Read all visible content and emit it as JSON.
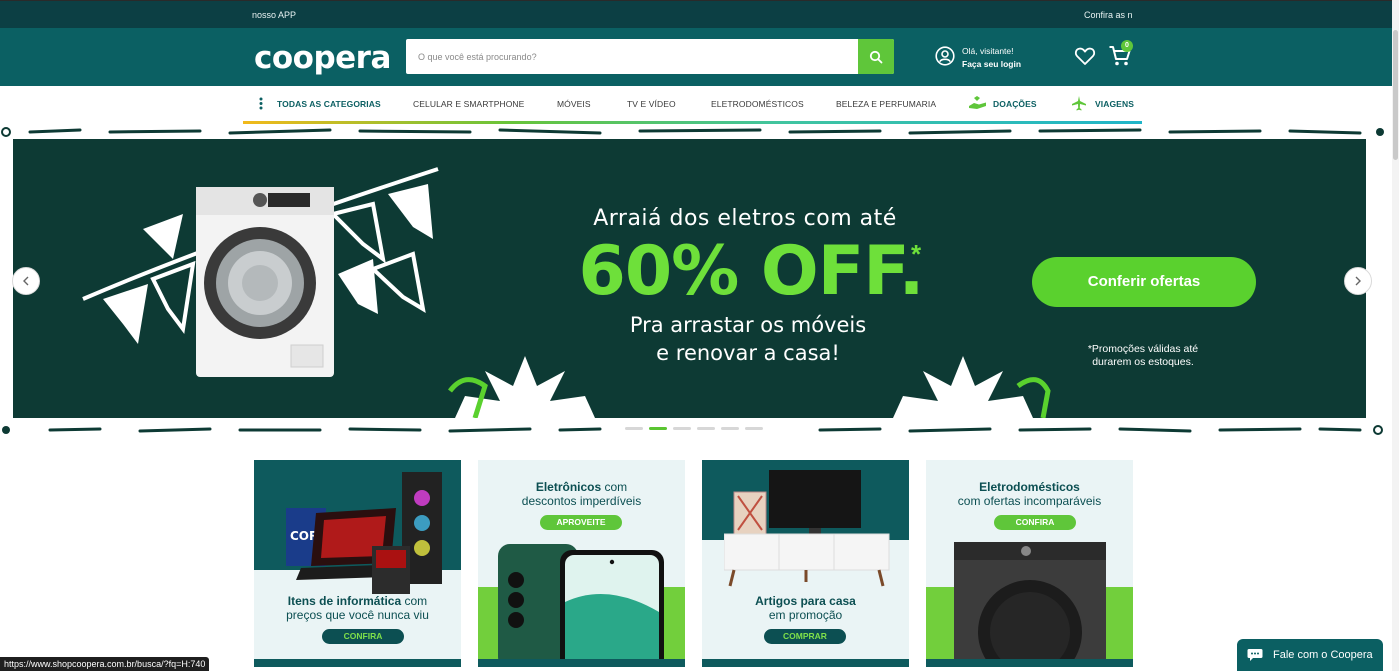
{
  "ticker": {
    "left": "nosso APP",
    "right": "Confira as n"
  },
  "header": {
    "logo": "coopera",
    "search_placeholder": "O que você está procurando?",
    "greeting": "Olá, visitante!",
    "login": "Faça seu login",
    "cart_count": "0",
    "icons": [
      "search-icon",
      "user-icon",
      "heart-icon",
      "cart-icon"
    ]
  },
  "nav": {
    "items": [
      "TODAS AS CATEGORIAS",
      "CELULAR E SMARTPHONE",
      "MÓVEIS",
      "TV E VÍDEO",
      "ELETRODOMÉSTICOS",
      "BELEZA E PERFUMARIA",
      "DOAÇÕES",
      "VIAGENS"
    ]
  },
  "hero": {
    "line1": "Arraiá dos eletros com até",
    "line2": "60% OFF.",
    "asterisk": "*",
    "line3": "Pra arrastar os móveis",
    "line4": "e renovar a casa!",
    "cta": "Conferir ofertas",
    "note1": "*Promoções válidas até",
    "note2": "durarem os estoques.",
    "slide_count": 6,
    "active_slide": 2
  },
  "cards": [
    {
      "title_bold": "Itens de informática",
      "title_rest": " com",
      "subtitle": "preços que você nunca viu",
      "button": "CONFIRA"
    },
    {
      "title_bold": "Eletrônicos",
      "title_rest": " com",
      "subtitle": "descontos imperdíveis",
      "button": "APROVEITE"
    },
    {
      "title_bold": "Artigos para casa",
      "title_rest": "",
      "subtitle": "em promoção",
      "button": "COMPRAR"
    },
    {
      "title_bold": "Eletrodomésticos",
      "title_rest": "",
      "subtitle": "com ofertas incomparáveis",
      "button": "CONFIRA"
    }
  ],
  "statusbar": "https://www.shopcoopera.com.br/busca/?fq=H:740",
  "chat": "Fale com o Coopera",
  "colors": {
    "brand_dark": "#0b6063",
    "brand_green": "#5fc63a",
    "hero_bg": "#0d3a34"
  }
}
